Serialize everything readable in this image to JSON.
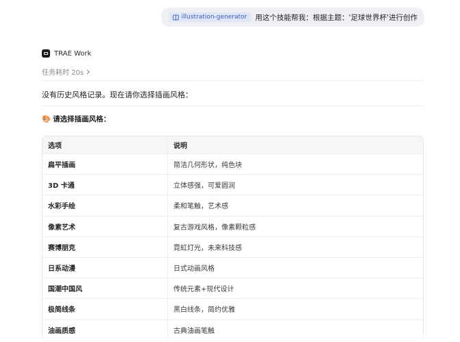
{
  "user_message": {
    "skill_chip": "illustration-generator",
    "text": "用这个技能帮我：根据主题：'足球世界杯'进行创作"
  },
  "agent": {
    "name": "TRAE Work",
    "task_time": "任务耗时 20s"
  },
  "response": {
    "intro": "没有历史风格记录。现在请你选择插画风格：",
    "section_emoji": "🎨",
    "section_title": "请选择插画风格："
  },
  "table": {
    "headers": [
      "选项",
      "说明"
    ],
    "rows": [
      {
        "option": "扁平插画",
        "desc": "简洁几何形状，纯色块"
      },
      {
        "option": "3D 卡通",
        "desc": "立体感强，可爱圆润"
      },
      {
        "option": "水彩手绘",
        "desc": "柔和笔触，艺术感"
      },
      {
        "option": "像素艺术",
        "desc": "复古游戏风格，像素颗粒感"
      },
      {
        "option": "赛博朋克",
        "desc": "霓虹灯光，未来科技感"
      },
      {
        "option": "日系动漫",
        "desc": "日式动画风格"
      },
      {
        "option": "国潮中国风",
        "desc": "传统元素+现代设计"
      },
      {
        "option": "极简线条",
        "desc": "黑白线条，简约优雅"
      },
      {
        "option": "油画质感",
        "desc": "古典油画笔触"
      }
    ]
  },
  "icons": {
    "skill": "book-icon",
    "agent": "trae-logo-icon",
    "chevron": "chevron-right-icon"
  }
}
